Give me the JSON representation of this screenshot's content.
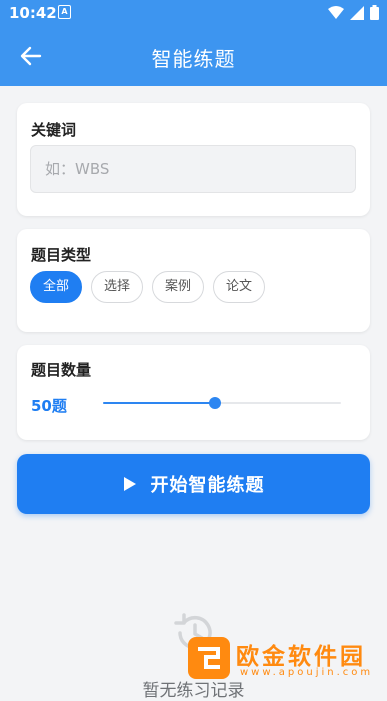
{
  "status_bar": {
    "time": "10:42",
    "notification_letter": "A"
  },
  "header": {
    "title": "智能练题"
  },
  "keyword": {
    "label": "关键词",
    "placeholder": "如：WBS",
    "value": ""
  },
  "question_type": {
    "label": "题目类型",
    "options": [
      "全部",
      "选择",
      "案例",
      "论文"
    ],
    "selected_index": 0
  },
  "question_count": {
    "label": "题目数量",
    "value_text": "50题",
    "slider_fraction": 0.47
  },
  "start_button": {
    "label": "开始智能练题"
  },
  "empty_state": {
    "text": "暂无练习记录"
  },
  "watermark": {
    "name": "欧金软件园",
    "url": "www.apoujin.com"
  },
  "colors": {
    "primary": "#1f7ef2",
    "header": "#3d95f0",
    "watermark": "#ff8a10"
  }
}
